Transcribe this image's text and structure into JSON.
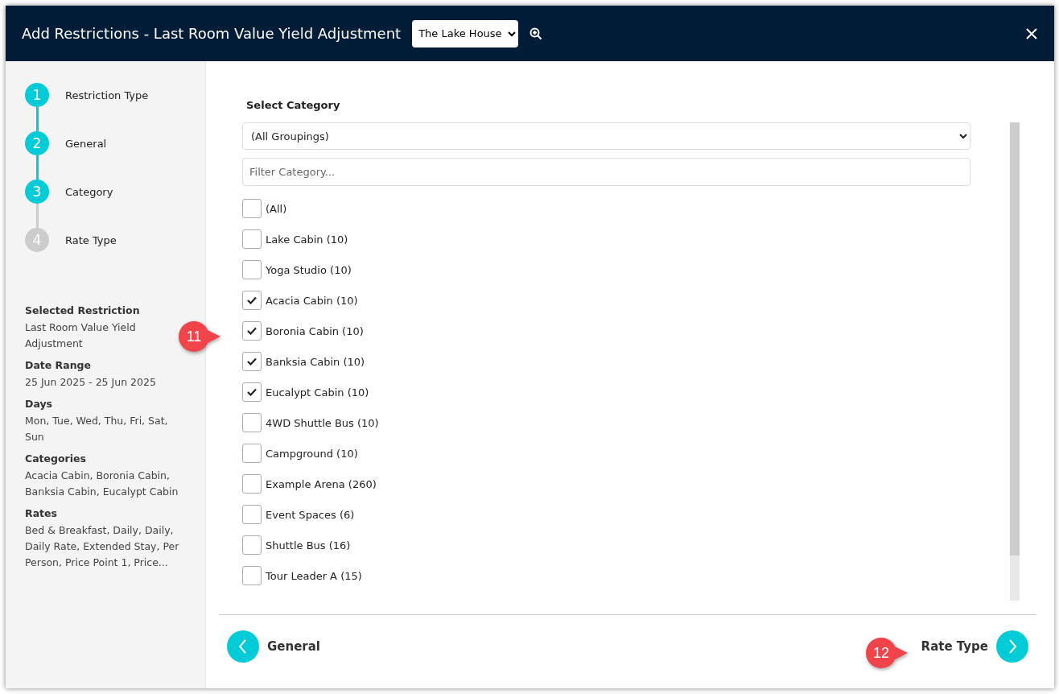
{
  "window": {
    "title": "Add Restrictions - Last Room Value Yield Adjustment",
    "property_select": {
      "value": "The Lake House"
    }
  },
  "steps": [
    {
      "number": "1",
      "label": "Restriction Type",
      "active": true
    },
    {
      "number": "2",
      "label": "General",
      "active": true
    },
    {
      "number": "3",
      "label": "Category",
      "active": true
    },
    {
      "number": "4",
      "label": "Rate Type",
      "active": false
    }
  ],
  "summary": [
    {
      "heading": "Selected Restriction",
      "value": "Last Room Value Yield Adjustment"
    },
    {
      "heading": "Date Range",
      "value": "25 Jun 2025 - 25 Jun 2025"
    },
    {
      "heading": "Days",
      "value": "Mon, Tue, Wed, Thu, Fri, Sat, Sun"
    },
    {
      "heading": "Categories",
      "value": "Acacia Cabin, Boronia Cabin, Banksia Cabin, Eucalypt Cabin"
    },
    {
      "heading": "Rates",
      "value": "Bed & Breakfast, Daily, Daily, Daily Rate, Extended Stay, Per Person, Price Point 1, Price..."
    }
  ],
  "category": {
    "heading": "Select Category",
    "grouping": "(All Groupings)",
    "filter_placeholder": "Filter Category...",
    "items": [
      {
        "label": "(All)",
        "checked": false
      },
      {
        "label": "Lake Cabin (10)",
        "checked": false
      },
      {
        "label": "Yoga Studio (10)",
        "checked": false
      },
      {
        "label": "Acacia Cabin (10)",
        "checked": true
      },
      {
        "label": "Boronia Cabin (10)",
        "checked": true
      },
      {
        "label": "Banksia Cabin (10)",
        "checked": true
      },
      {
        "label": "Eucalypt Cabin (10)",
        "checked": true
      },
      {
        "label": "4WD Shuttle Bus (10)",
        "checked": false
      },
      {
        "label": "Campground (10)",
        "checked": false
      },
      {
        "label": "Example Arena (260)",
        "checked": false
      },
      {
        "label": "Event Spaces (6)",
        "checked": false
      },
      {
        "label": "Shuttle Bus (16)",
        "checked": false
      },
      {
        "label": "Tour Leader A (15)",
        "checked": false
      }
    ]
  },
  "footer": {
    "back": "General",
    "next": "Rate Type"
  },
  "callouts": [
    {
      "number": "11"
    },
    {
      "number": "12"
    }
  ]
}
